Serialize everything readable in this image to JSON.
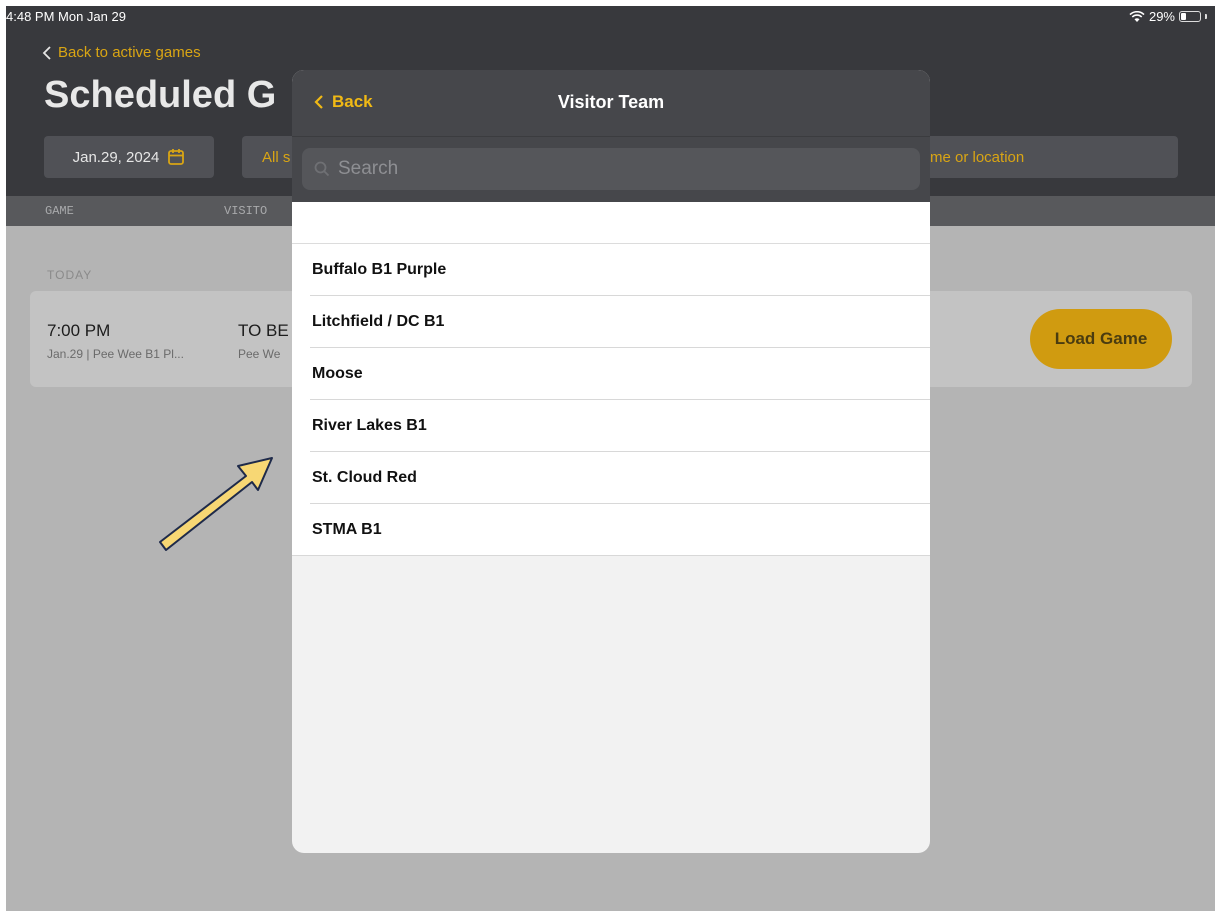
{
  "status_bar": {
    "time": "4:48 PM  Mon Jan 29",
    "battery_text": "29%",
    "battery_level": 0.29
  },
  "header": {
    "back_label": "Back to active games",
    "title": "Scheduled G",
    "date": "Jan.29, 2024",
    "status_filter": "All s",
    "search_filter": "me or location"
  },
  "columns": {
    "game": "GAME",
    "visitor": "VISITO"
  },
  "section": {
    "today": "TODAY"
  },
  "game": {
    "time": "7:00 PM",
    "subtitle": "Jan.29 | Pee Wee B1 Pl...",
    "visitor": "TO BE",
    "visitor_sub": "Pee We",
    "load_label": "Load Game"
  },
  "modal": {
    "back_label": "Back",
    "title": "Visitor Team",
    "search_placeholder": "Search",
    "teams": [
      "Buffalo B1 Purple",
      "Litchfield / DC B1",
      "Moose",
      "River Lakes B1",
      "St. Cloud Red",
      "STMA B1"
    ]
  },
  "colors": {
    "accent": "#d9a514",
    "header_bg": "#38393d",
    "modal_header_bg": "#46474b",
    "arrow_fill": "#f7d774",
    "arrow_stroke": "#1e2a4a"
  }
}
